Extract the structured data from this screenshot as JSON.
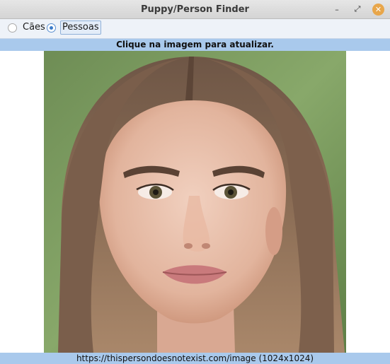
{
  "window": {
    "title": "Puppy/Person Finder",
    "min_glyph": "–",
    "max_glyph": "⤢",
    "close_glyph": "✕"
  },
  "mode": {
    "options": [
      "Cães",
      "Pessoas"
    ],
    "selected": "Pessoas"
  },
  "instruction": "Clique na imagem para atualizar.",
  "image": {
    "description": "portrait photo"
  },
  "footer": {
    "source": "https://thispersondoesnotexist.com/image (1024x1024)"
  },
  "colors": {
    "accent": "#a9c9ec",
    "close": "#e8a64a"
  }
}
